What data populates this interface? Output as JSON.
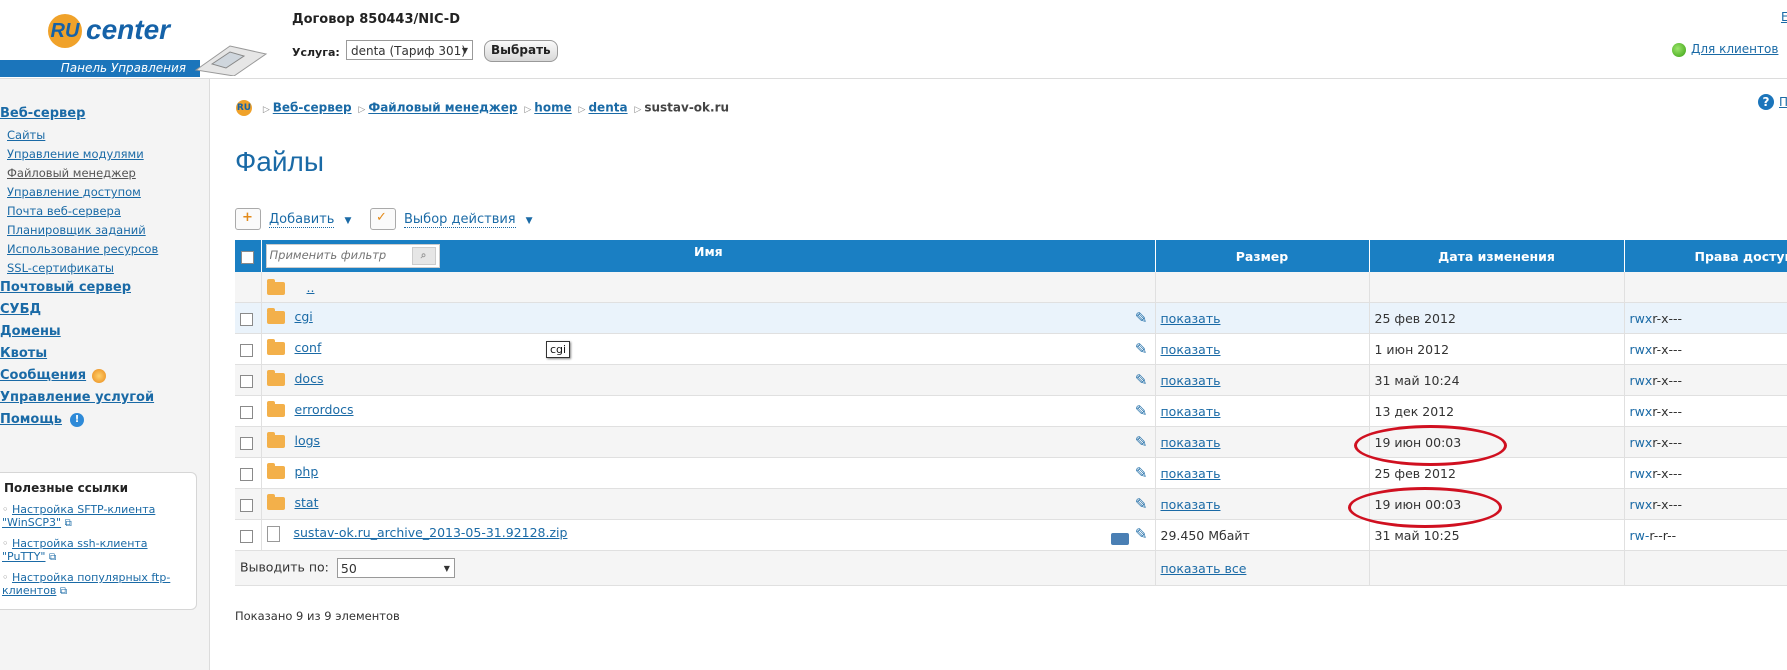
{
  "header": {
    "logo_ru": "RU",
    "logo_center": "center",
    "logo_panel": "Панель Управления",
    "contract": "Договор 850443/NIC-D",
    "service_label": "Услуга:",
    "service_value": "denta (Тариф 301)",
    "choose_button": "Выбрать",
    "clients_link": "Для клиентов",
    "edge_link": "E"
  },
  "sidebar": {
    "web_server": "Веб-сервер",
    "web_items": [
      "Сайты",
      "Управление модулями",
      "Файловый менеджер",
      "Управление доступом",
      "Почта веб-сервера",
      "Планировщик заданий",
      "Использование ресурсов",
      "SSL-сертификаты"
    ],
    "mail_server": "Почтовый сервер",
    "dbms": "СУБД",
    "domains": "Домены",
    "quotas": "Квоты",
    "messages": "Сообщения",
    "service_mgmt": "Управление услугой",
    "help": "Помощь",
    "useful_title": "Полезные ссылки",
    "useful_links": [
      "Настройка SFTP-клиента \"WinSCP3\"",
      "Настройка ssh-клиента \"PuTTY\"",
      "Настройка популярных ftp-клиентов"
    ]
  },
  "breadcrumb": {
    "items": [
      "Веб-сервер",
      "Файловый менеджер",
      "home",
      "denta"
    ],
    "current": "sustav-ok.ru",
    "help_edge": "П"
  },
  "page": {
    "title": "Файлы",
    "add_label": "Добавить",
    "actions_label": "Выбор действия"
  },
  "table": {
    "filter_placeholder": "Применить фильтр",
    "headers": {
      "name": "Имя",
      "size": "Размер",
      "date": "Дата изменения",
      "perms": "Права доступа"
    },
    "parent": "..",
    "rows": [
      {
        "name": "cgi",
        "size": "показать",
        "date": "25 фев 2012",
        "perm_x": "rwx",
        "perm_rest": "r-x---"
      },
      {
        "name": "conf",
        "size": "показать",
        "date": "1 июн 2012",
        "perm_x": "rwx",
        "perm_rest": "r-x---"
      },
      {
        "name": "docs",
        "size": "показать",
        "date": "31 май 10:24",
        "perm_x": "rwx",
        "perm_rest": "r-x---"
      },
      {
        "name": "errordocs",
        "size": "показать",
        "date": "13 дек 2012",
        "perm_x": "rwx",
        "perm_rest": "r-x---"
      },
      {
        "name": "logs",
        "size": "показать",
        "date": "19 июн 00:03",
        "perm_x": "rwx",
        "perm_rest": "r-x---"
      },
      {
        "name": "php",
        "size": "показать",
        "date": "25 фев 2012",
        "perm_x": "rwx",
        "perm_rest": "r-x---"
      },
      {
        "name": "stat",
        "size": "показать",
        "date": "19 июн 00:03",
        "perm_x": "rwx",
        "perm_rest": "r-x---"
      },
      {
        "name": "sustav-ok.ru_archive_2013-05-31.92128.zip",
        "size": "29.450 Мбайт",
        "date": "31 май 10:25",
        "perm_x": "rw-",
        "perm_rest": "r--r--"
      }
    ],
    "tooltip": "cgi",
    "per_page_label": "Выводить по:",
    "per_page_value": "50",
    "show_all": "показать все",
    "shown_text": "Показано 9 из 9 элементов"
  },
  "colors": {
    "accent": "#1a7fc3",
    "link": "#1a6aa6",
    "annotation": "#d01020"
  }
}
